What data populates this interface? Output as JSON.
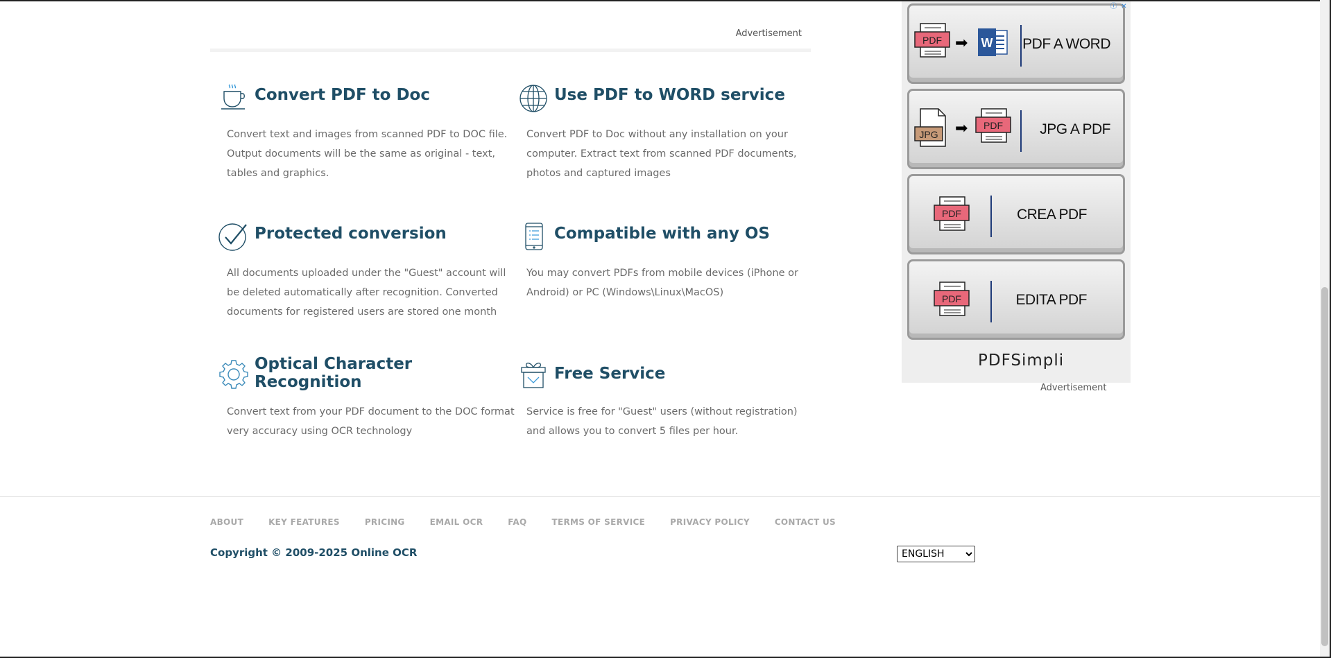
{
  "ad_label_top": "Advertisement",
  "features": [
    {
      "title": "Convert PDF to Doc",
      "icon": "coffee-cup-icon",
      "desc": [
        "Convert text and images from scanned PDF to DOC file.",
        "Output documents will be the same as original - text,",
        "tables and graphics."
      ]
    },
    {
      "title": "Use PDF to WORD service",
      "icon": "globe-icon",
      "desc": [
        "Convert PDF to Doc without any installation on your",
        "computer. Extract text from scanned PDF documents,",
        "photos and captured images"
      ]
    },
    {
      "title": "Protected conversion",
      "icon": "checkmark-circle-icon",
      "desc": [
        "All documents uploaded under the \"Guest\" account will",
        "be deleted automatically after recognition. Converted",
        "documents for registered users are stored one month"
      ]
    },
    {
      "title": "Compatible with any OS",
      "icon": "tablet-icon",
      "desc": [
        "You may convert PDFs from mobile devices (iPhone or",
        "Android) or PC (Windows\\Linux\\MacOS)"
      ]
    },
    {
      "title_lines": [
        "Optical Character",
        "Recognition"
      ],
      "icon": "gear-icon",
      "desc": [
        "Convert text from your PDF document to the DOC format",
        "very accuracy using OCR technology"
      ]
    },
    {
      "title": "Free Service",
      "icon": "gift-icon",
      "desc": [
        "Service is free for \"Guest\" users (without registration)",
        "and allows you to convert 5 files per hour."
      ]
    }
  ],
  "footer": {
    "nav": [
      "ABOUT",
      "KEY FEATURES",
      "PRICING",
      "EMAIL OCR",
      "FAQ",
      "TERMS OF SERVICE",
      "PRIVACY POLICY",
      "CONTACT US"
    ],
    "copyright": "Copyright © 2009-2025 Online OCR",
    "language": "ENGLISH"
  },
  "ad": {
    "buttons": [
      "PDF A WORD",
      "JPG A PDF",
      "CREA PDF",
      "EDITA PDF"
    ],
    "brand": "PDFSimpli",
    "doc_labels": {
      "pdf": "PDF",
      "jpg": "JPG"
    },
    "label_bottom": "Advertisement"
  },
  "colors": {
    "heading": "#1f4e66",
    "text": "#6b6b6b",
    "nav": "#a9a9a9",
    "pdf_red": "#e8687a"
  }
}
